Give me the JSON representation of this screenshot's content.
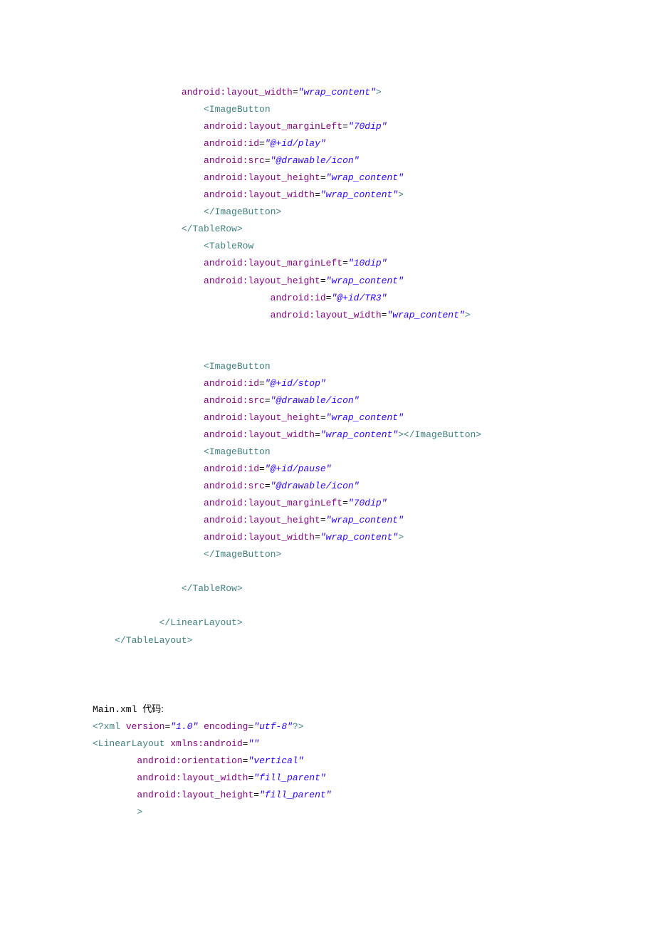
{
  "lines": [
    {
      "indent": 4,
      "segments": [
        {
          "cls": "attr-name",
          "t": "android:layout_width"
        },
        {
          "cls": "eq",
          "t": "="
        },
        {
          "cls": "attr-val",
          "t": "\"wrap_content\""
        },
        {
          "cls": "tag-name",
          "t": ">"
        }
      ]
    },
    {
      "indent": 5,
      "segments": [
        {
          "cls": "tag-name",
          "t": "<ImageButton"
        }
      ]
    },
    {
      "indent": 5,
      "segments": [
        {
          "cls": "attr-name",
          "t": "android:layout_marginLeft"
        },
        {
          "cls": "eq",
          "t": "="
        },
        {
          "cls": "attr-val",
          "t": "\"70dip\""
        }
      ]
    },
    {
      "indent": 5,
      "segments": [
        {
          "cls": "attr-name",
          "t": "android:id"
        },
        {
          "cls": "eq",
          "t": "="
        },
        {
          "cls": "attr-val",
          "t": "\"@+id/play\""
        }
      ]
    },
    {
      "indent": 5,
      "segments": [
        {
          "cls": "attr-name",
          "t": "android:src"
        },
        {
          "cls": "eq",
          "t": "="
        },
        {
          "cls": "attr-val",
          "t": "\"@drawable/icon\""
        }
      ]
    },
    {
      "indent": 5,
      "segments": [
        {
          "cls": "attr-name",
          "t": "android:layout_height"
        },
        {
          "cls": "eq",
          "t": "="
        },
        {
          "cls": "attr-val",
          "t": "\"wrap_content\""
        }
      ]
    },
    {
      "indent": 5,
      "segments": [
        {
          "cls": "attr-name",
          "t": "android:layout_width"
        },
        {
          "cls": "eq",
          "t": "="
        },
        {
          "cls": "attr-val",
          "t": "\"wrap_content\""
        },
        {
          "cls": "tag-name",
          "t": ">"
        }
      ]
    },
    {
      "indent": 5,
      "segments": [
        {
          "cls": "tag-name",
          "t": "</ImageButton>"
        }
      ]
    },
    {
      "indent": 4,
      "segments": [
        {
          "cls": "tag-name",
          "t": "</TableRow>"
        }
      ]
    },
    {
      "indent": 5,
      "segments": [
        {
          "cls": "tag-name",
          "t": "<TableRow"
        }
      ]
    },
    {
      "indent": 5,
      "segments": [
        {
          "cls": "attr-name",
          "t": "android:layout_marginLeft"
        },
        {
          "cls": "eq",
          "t": "="
        },
        {
          "cls": "attr-val",
          "t": "\"10dip\""
        }
      ]
    },
    {
      "indent": 5,
      "segments": [
        {
          "cls": "attr-name",
          "t": "android:layout_height"
        },
        {
          "cls": "eq",
          "t": "="
        },
        {
          "cls": "attr-val",
          "t": "\"wrap_content\""
        }
      ]
    },
    {
      "indent": 8,
      "segments": [
        {
          "cls": "attr-name",
          "t": "android:id"
        },
        {
          "cls": "eq",
          "t": "="
        },
        {
          "cls": "attr-val",
          "t": "\"@+id/TR3\""
        }
      ]
    },
    {
      "indent": 8,
      "segments": [
        {
          "cls": "attr-name",
          "t": "android:layout_width"
        },
        {
          "cls": "eq",
          "t": "="
        },
        {
          "cls": "attr-val",
          "t": "\"wrap_content\""
        },
        {
          "cls": "tag-name",
          "t": ">"
        }
      ]
    },
    {
      "indent": 0,
      "gap": true
    },
    {
      "indent": 0,
      "gap": true
    },
    {
      "indent": 5,
      "segments": [
        {
          "cls": "tag-name",
          "t": "<ImageButton"
        }
      ]
    },
    {
      "indent": 5,
      "segments": [
        {
          "cls": "attr-name",
          "t": "android:id"
        },
        {
          "cls": "eq",
          "t": "="
        },
        {
          "cls": "attr-val",
          "t": "\"@+id/stop\""
        }
      ]
    },
    {
      "indent": 5,
      "segments": [
        {
          "cls": "attr-name",
          "t": "android:src"
        },
        {
          "cls": "eq",
          "t": "="
        },
        {
          "cls": "attr-val",
          "t": "\"@drawable/icon\""
        }
      ]
    },
    {
      "indent": 5,
      "segments": [
        {
          "cls": "attr-name",
          "t": "android:layout_height"
        },
        {
          "cls": "eq",
          "t": "="
        },
        {
          "cls": "attr-val",
          "t": "\"wrap_content\""
        }
      ]
    },
    {
      "indent": 5,
      "segments": [
        {
          "cls": "attr-name",
          "t": "android:layout_width"
        },
        {
          "cls": "eq",
          "t": "="
        },
        {
          "cls": "attr-val",
          "t": "\"wrap_content\""
        },
        {
          "cls": "tag-name",
          "t": "></ImageButton>"
        }
      ]
    },
    {
      "indent": 5,
      "segments": [
        {
          "cls": "tag-name",
          "t": "<ImageButton"
        }
      ]
    },
    {
      "indent": 5,
      "segments": [
        {
          "cls": "attr-name",
          "t": "android:id"
        },
        {
          "cls": "eq",
          "t": "="
        },
        {
          "cls": "attr-val",
          "t": "\"@+id/pause\""
        }
      ]
    },
    {
      "indent": 5,
      "segments": [
        {
          "cls": "attr-name",
          "t": "android:src"
        },
        {
          "cls": "eq",
          "t": "="
        },
        {
          "cls": "attr-val",
          "t": "\"@drawable/icon\""
        }
      ]
    },
    {
      "indent": 5,
      "segments": [
        {
          "cls": "attr-name",
          "t": "android:layout_marginLeft"
        },
        {
          "cls": "eq",
          "t": "="
        },
        {
          "cls": "attr-val",
          "t": "\"70dip\""
        }
      ]
    },
    {
      "indent": 5,
      "segments": [
        {
          "cls": "attr-name",
          "t": "android:layout_height"
        },
        {
          "cls": "eq",
          "t": "="
        },
        {
          "cls": "attr-val",
          "t": "\"wrap_content\""
        }
      ]
    },
    {
      "indent": 5,
      "segments": [
        {
          "cls": "attr-name",
          "t": "android:layout_width"
        },
        {
          "cls": "eq",
          "t": "="
        },
        {
          "cls": "attr-val",
          "t": "\"wrap_content\""
        },
        {
          "cls": "tag-name",
          "t": ">"
        }
      ]
    },
    {
      "indent": 5,
      "segments": [
        {
          "cls": "tag-name",
          "t": "</ImageButton>"
        }
      ]
    },
    {
      "indent": 0,
      "gap": true
    },
    {
      "indent": 4,
      "segments": [
        {
          "cls": "tag-name",
          "t": "</TableRow>"
        }
      ]
    },
    {
      "indent": 0,
      "gap": true
    },
    {
      "indent": 3,
      "segments": [
        {
          "cls": "tag-name",
          "t": "</LinearLayout>"
        }
      ]
    },
    {
      "indent": 1,
      "segments": [
        {
          "cls": "tag-name",
          "t": "</TableLayout>"
        }
      ]
    },
    {
      "indent": 0,
      "gap": true
    },
    {
      "indent": 0,
      "gap": true
    },
    {
      "indent": 0,
      "gap": true
    },
    {
      "indent": 0,
      "segments": [
        {
          "cls": "plain",
          "t": "Main.xml "
        },
        {
          "cls": "plain cjk",
          "t": "代码:"
        }
      ]
    },
    {
      "indent": 0,
      "segments": [
        {
          "cls": "tag-name",
          "t": "<?"
        },
        {
          "cls": "tag-name",
          "t": "xml"
        },
        {
          "cls": "plain",
          "t": " "
        },
        {
          "cls": "attr-name",
          "t": "version"
        },
        {
          "cls": "eq",
          "t": "="
        },
        {
          "cls": "attr-val",
          "t": "\"1.0\""
        },
        {
          "cls": "plain",
          "t": " "
        },
        {
          "cls": "attr-name",
          "t": "encoding"
        },
        {
          "cls": "eq",
          "t": "="
        },
        {
          "cls": "attr-val",
          "t": "\"utf-8\""
        },
        {
          "cls": "tag-name",
          "t": "?>"
        }
      ]
    },
    {
      "indent": 0,
      "segments": [
        {
          "cls": "tag-name",
          "t": "<LinearLayout"
        },
        {
          "cls": "plain",
          "t": " "
        },
        {
          "cls": "attr-name",
          "t": "xmlns:android"
        },
        {
          "cls": "eq",
          "t": "="
        },
        {
          "cls": "attr-val",
          "t": "\"\""
        }
      ]
    },
    {
      "indent": 2,
      "segments": [
        {
          "cls": "attr-name",
          "t": "android:orientation"
        },
        {
          "cls": "eq",
          "t": "="
        },
        {
          "cls": "attr-val",
          "t": "\"vertical\""
        }
      ]
    },
    {
      "indent": 2,
      "segments": [
        {
          "cls": "attr-name",
          "t": "android:layout_width"
        },
        {
          "cls": "eq",
          "t": "="
        },
        {
          "cls": "attr-val",
          "t": "\"fill_parent\""
        }
      ]
    },
    {
      "indent": 2,
      "segments": [
        {
          "cls": "attr-name",
          "t": "android:layout_height"
        },
        {
          "cls": "eq",
          "t": "="
        },
        {
          "cls": "attr-val",
          "t": "\"fill_parent\""
        }
      ]
    },
    {
      "indent": 2,
      "segments": [
        {
          "cls": "tag-name",
          "t": ">"
        }
      ]
    }
  ],
  "indentUnit": "    "
}
